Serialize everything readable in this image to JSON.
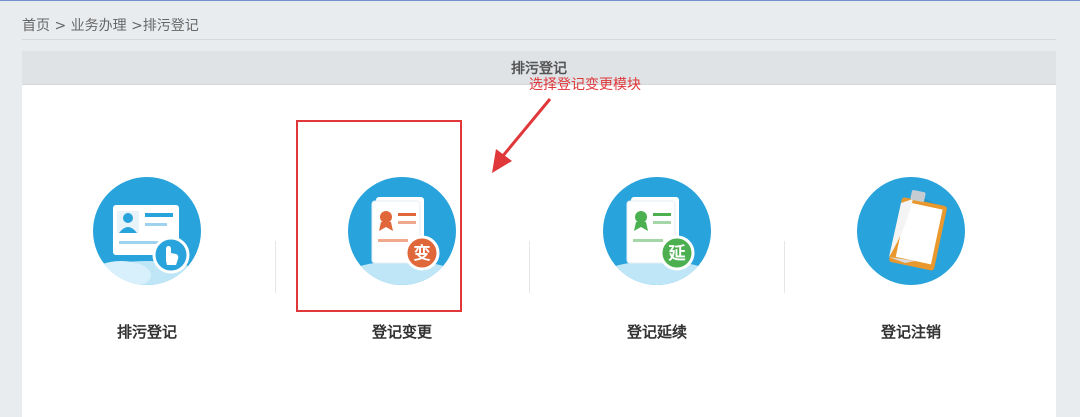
{
  "breadcrumb": "首页 > 业务办理 >排污登记",
  "panel": {
    "title": "排污登记"
  },
  "modules": [
    {
      "label": "排污登记",
      "icon": "register-hand-icon"
    },
    {
      "label": "登记变更",
      "icon": "change-certificate-icon",
      "badge": "变"
    },
    {
      "label": "登记延续",
      "icon": "extend-certificate-icon",
      "badge": "延"
    },
    {
      "label": "登记注销",
      "icon": "cancel-clipboard-icon"
    }
  ],
  "annotation": {
    "text": "选择登记变更模块",
    "color": "#e0373a"
  },
  "colors": {
    "circle_blue": "#29a3dc",
    "highlight_red": "#e0373a",
    "badge_orange": "#e0673a",
    "badge_green": "#4caf50"
  }
}
